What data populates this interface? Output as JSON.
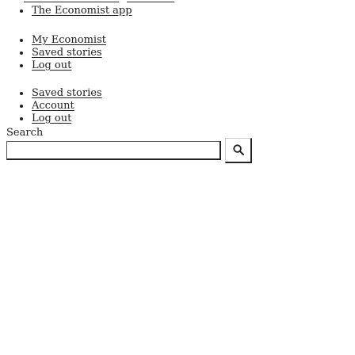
{
  "app_menu": {
    "items": [
      {
        "label": "The Economist app"
      }
    ]
  },
  "account_menu_primary": {
    "items": [
      {
        "label": "My Economist"
      },
      {
        "label": "Saved stories"
      },
      {
        "label": "Log out"
      }
    ]
  },
  "account_menu_secondary": {
    "items": [
      {
        "label": "Saved stories"
      },
      {
        "label": "Account"
      },
      {
        "label": "Log out"
      }
    ]
  },
  "search": {
    "label": "Search",
    "value": "",
    "button_icon": "search-icon"
  },
  "colors": {
    "text": "#222222",
    "background": "#ffffff",
    "border": "#222222"
  }
}
